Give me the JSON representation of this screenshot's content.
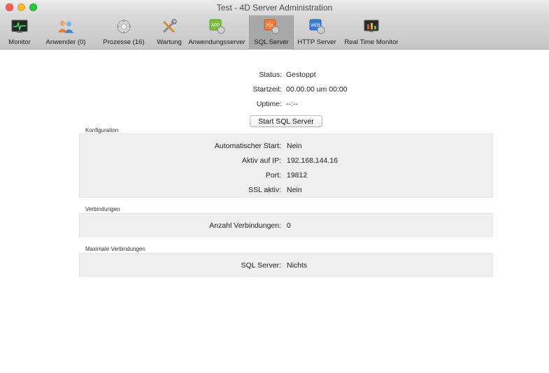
{
  "window": {
    "title": "Test - 4D Server Administration"
  },
  "toolbar": {
    "items": [
      {
        "label": "Monitor",
        "icon": "monitor-icon"
      },
      {
        "label": "Anwender (0)",
        "icon": "users-icon"
      },
      {
        "label": "Prozesse (16)",
        "icon": "processes-icon"
      },
      {
        "label": "Wartung",
        "icon": "maintenance-icon"
      },
      {
        "label": "Anwendungsserver",
        "icon": "app-server-icon",
        "badge": "APP"
      },
      {
        "label": "SQL Server",
        "icon": "sql-server-icon",
        "badge": "SQL",
        "active": true
      },
      {
        "label": "HTTP Server",
        "icon": "http-server-icon",
        "badge": "WEB"
      },
      {
        "label": "Real Time Monitor",
        "icon": "real-time-monitor-icon"
      }
    ]
  },
  "status": {
    "status_label": "Status:",
    "status_value": "Gestoppt",
    "start_label": "Startzeit:",
    "start_value": "00.00.00 um 00:00",
    "uptime_label": "Uptime:",
    "uptime_value": "--:--"
  },
  "start_button": "Start SQL Server",
  "konfiguration": {
    "title": "Konfiguration",
    "auto_label": "Automatischer Start:",
    "auto_value": "Nein",
    "ip_label": "Aktiv auf IP:",
    "ip_value": "192.168.144.16",
    "port_label": "Port:",
    "port_value": "19812",
    "ssl_label": "SSL aktiv:",
    "ssl_value": "Nein"
  },
  "verbindungen": {
    "title": "Verbindungen",
    "count_label": "Anzahl Verbindungen:",
    "count_value": "0"
  },
  "maximale": {
    "title": "Maximale Verbindungen",
    "sql_label": "SQL Server:",
    "sql_value": "Nichts"
  }
}
